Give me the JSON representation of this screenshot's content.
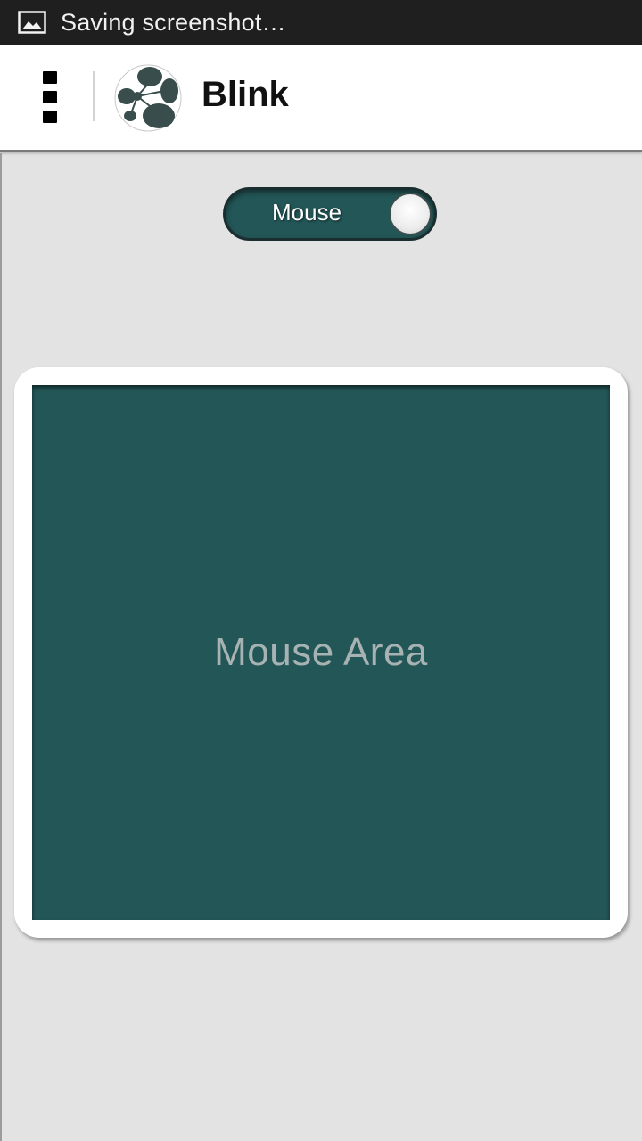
{
  "status_bar": {
    "notification_icon": "image-icon",
    "text": "Saving screenshot…"
  },
  "action_bar": {
    "menu_icon": "overflow-menu-icon",
    "logo_icon": "blink-logo-icon",
    "title": "Blink"
  },
  "mode_toggle": {
    "label": "Mouse",
    "state": "on"
  },
  "mouse_area": {
    "label": "Mouse Area"
  },
  "colors": {
    "accent": "#235657",
    "background": "#e3e3e3",
    "status_bar": "#1f1f1f"
  }
}
